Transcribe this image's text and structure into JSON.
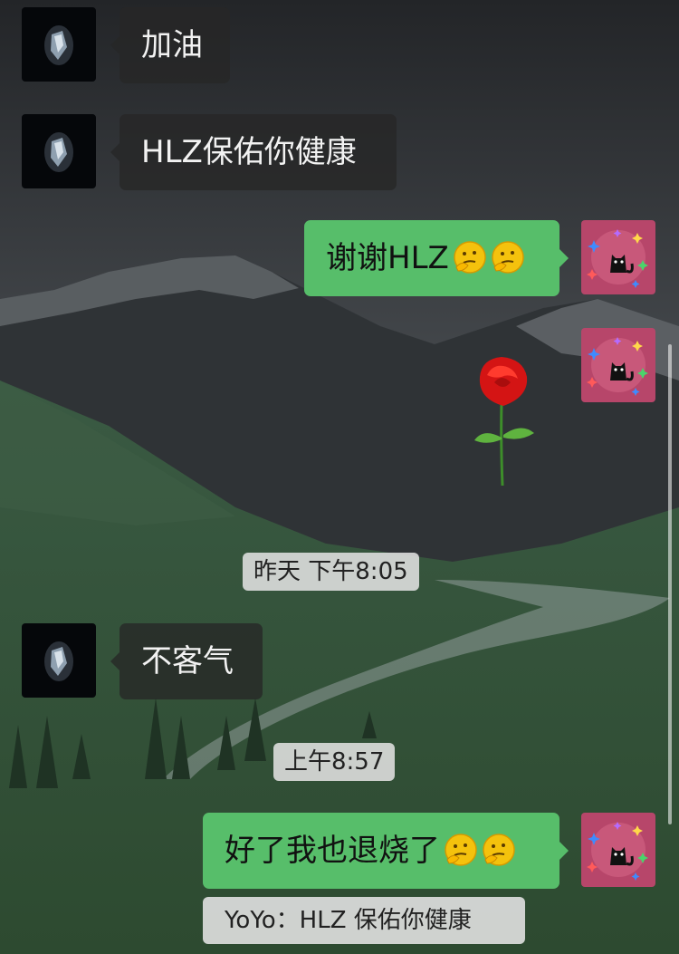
{
  "messages": [
    {
      "sender": "other",
      "text": "加油"
    },
    {
      "sender": "other",
      "text": "HLZ保佑你健康"
    },
    {
      "sender": "self",
      "text": "谢谢HLZ",
      "emojis": [
        "thinking-face",
        "thinking-face"
      ]
    },
    {
      "sender": "self",
      "sticker": "rose"
    },
    {
      "sender": "other",
      "text": "不客气"
    },
    {
      "sender": "self",
      "text": "好了我也退烧了",
      "emojis": [
        "thinking-face",
        "thinking-face"
      ]
    }
  ],
  "timestamps": {
    "yesterday": "昨天 下午8:05",
    "morning": "上午8:57"
  },
  "quote": {
    "text": "YoYo：HLZ 保佑你健康"
  },
  "colors": {
    "sent_bubble": "#57be6a",
    "received_bubble": "#262626",
    "timestamp_bg": "#e1e1e1"
  },
  "icons": {
    "other_avatar": "dark-figure-avatar",
    "self_avatar": "black-cat-sparkle-avatar",
    "emoji": "thinking-face",
    "sticker": "rose"
  }
}
